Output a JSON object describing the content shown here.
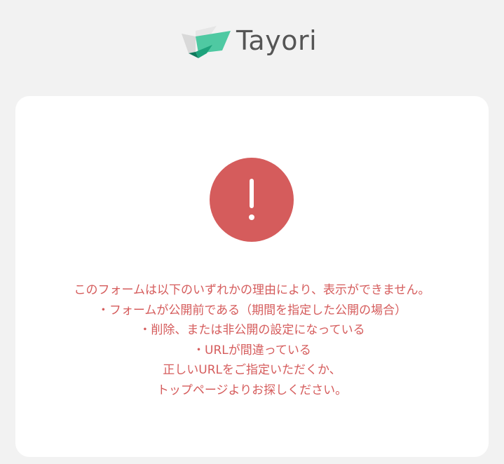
{
  "brand": {
    "name": "Tayori",
    "logo_icon": "paper-plane-envelope-icon",
    "colors": {
      "text": "#555555",
      "mark_light": "#4fc9a2",
      "mark_dark": "#1ea37c",
      "mark_gray": "#d9d9d9"
    }
  },
  "alert": {
    "icon": "exclamation-circle-icon",
    "color": "#d55c5c"
  },
  "message": {
    "lines": [
      "このフォームは以下のいずれかの理由により、表示ができません。",
      "・フォームが公開前である（期間を指定した公開の場合）",
      "・削除、または非公開の設定になっている",
      "・URLが間違っている",
      "正しいURLをご指定いただくか、",
      "トップページよりお探しください。"
    ]
  },
  "colors": {
    "page_background": "#f2f2f2",
    "card_background": "#ffffff"
  }
}
